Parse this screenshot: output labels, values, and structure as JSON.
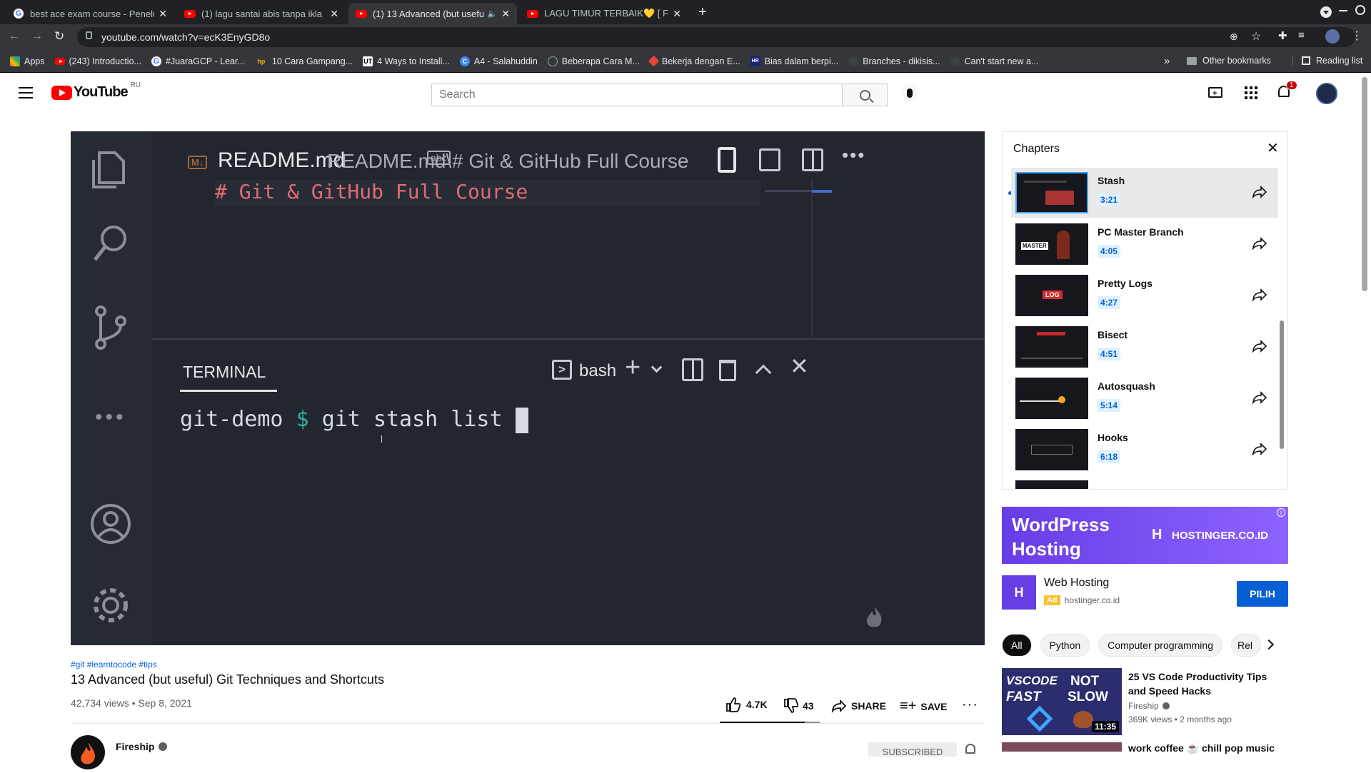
{
  "browser": {
    "tabs": [
      {
        "title": "best ace exam course - Penelu",
        "favicon": "google"
      },
      {
        "title": "(1) lagu santai abis tanpa ikla",
        "favicon": "youtube"
      },
      {
        "title": "(1) 13 Advanced (but usefu",
        "favicon": "youtube",
        "active": true
      },
      {
        "title": "LAGU TIMUR TERBAIK💛 [ Full",
        "favicon": "youtube"
      }
    ],
    "new_tab": "+",
    "url": "youtube.com/watch?v=ecK3EnyGD8o",
    "bookmarks": [
      {
        "label": "Apps",
        "color": "#ea4335"
      },
      {
        "label": "(243) Introductio...",
        "color": "#ff0000"
      },
      {
        "label": "#JuaraGCP - Lear...",
        "color": "#ffffff"
      },
      {
        "label": "10 Cara Gampang...",
        "color": "#f4b400"
      },
      {
        "label": "4 Ways to Install...",
        "color": "#ffffff"
      },
      {
        "label": "A4 - Salahuddin",
        "color": "#4285f4"
      },
      {
        "label": "Beberapa Cara M...",
        "color": "#9aa0a6"
      },
      {
        "label": "Bekerja dengan E...",
        "color": "#e8453c"
      },
      {
        "label": "Bias dalam berpi...",
        "color": "#1a237e"
      },
      {
        "label": "Branches - dikisis...",
        "color": "#3c4043"
      },
      {
        "label": "Can't start new a...",
        "color": "#3c4043"
      }
    ],
    "bookmarks_overflow": "»",
    "other_bookmarks": "Other bookmarks",
    "reading_list": "Reading list"
  },
  "youtube": {
    "logo_text": "YouTube",
    "region": "RU",
    "search_placeholder": "Search",
    "notification_count": "1"
  },
  "video_frame": {
    "editor_tab_title": "README.md",
    "editor_breadcrumb": "README.md\\",
    "abc_badge": "abc",
    "breadcrumb_heading": "# Git & GitHub Full Course",
    "editor_line": "# Git & GitHub Full Course",
    "md_badge": "M↓",
    "terminal_tab": "TERMINAL",
    "shell_name": "bash",
    "prompt_dir": "git-demo",
    "prompt_symbol": "$",
    "command": "git stash list"
  },
  "video_info": {
    "hashtags": "#git #learntocode #tips",
    "title": "13 Advanced (but useful) Git Techniques and Shortcuts",
    "meta": "42,734 views • Sep 8, 2021",
    "likes": "4.7K",
    "dislikes": "43",
    "share_label": "SHARE",
    "save_label": "SAVE",
    "channel_name": "Fireship",
    "subscribed_label": "SUBSCRIBED"
  },
  "chapters": {
    "heading": "Chapters",
    "items": [
      {
        "title": "Stash",
        "time": "3:21",
        "selected": true
      },
      {
        "title": "PC Master Branch",
        "time": "4:05"
      },
      {
        "title": "Pretty Logs",
        "time": "4:27"
      },
      {
        "title": "Bisect",
        "time": "4:51"
      },
      {
        "title": "Autosquash",
        "time": "5:14"
      },
      {
        "title": "Hooks",
        "time": "6:18"
      }
    ],
    "thumb_labels": {
      "master": "MASTER",
      "log": "LOG"
    }
  },
  "ad": {
    "banner_line1": "WordPress",
    "banner_line2": "Hosting",
    "brand": "HOSTINGER.CO.ID",
    "title": "Web Hosting",
    "badge": "Ad",
    "domain": "hostinger.co.id",
    "cta": "PILIH"
  },
  "chips": [
    "All",
    "Python",
    "Computer programming",
    "Rel"
  ],
  "recommendations": [
    {
      "title_line1": "25 VS Code Productivity Tips",
      "title_line2": "and Speed Hacks",
      "channel": "Fireship",
      "meta": "369K views • 2 months ago",
      "duration": "11:35",
      "thumb_text1": "VSCODE",
      "thumb_text2": "FAST",
      "thumb_text3": "NOT",
      "thumb_text4": "SLOW"
    },
    {
      "title_line1": "work coffee ☕ chill pop music"
    }
  ],
  "colors": {
    "accent": "#3ea6ff",
    "youtube_red": "#ff0000",
    "link_blue": "#065fd4",
    "vscode_bg": "#23262e",
    "hostinger_purple": "#673de6"
  }
}
